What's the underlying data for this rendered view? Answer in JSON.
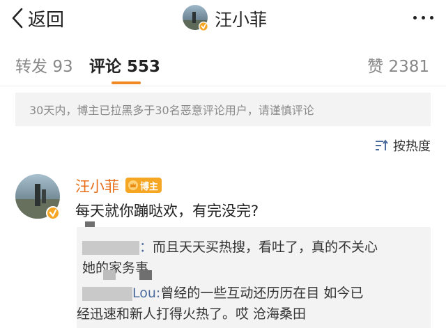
{
  "navbar": {
    "back_label": "返回",
    "title": "汪小菲"
  },
  "tabs": [
    {
      "label": "转发",
      "count": "93"
    },
    {
      "label": "评论",
      "count": "553"
    },
    {
      "label": "赞",
      "count": "2381"
    }
  ],
  "notice": "30天内，博主已拉黑多于30名恶意评论用户，请谨慎评论",
  "sort": {
    "label": "按热度"
  },
  "comment": {
    "author": "汪小菲",
    "tag": "博主",
    "text": "每天就你蹦哒欢，有完没完?"
  },
  "replies": [
    {
      "user_suffix": "：",
      "line1": "而且天天买热搜，看吐了，真的不关心",
      "line2": "她的家务事"
    },
    {
      "user_suffix": "Lou:",
      "line1": "曾经的一些互动还历历在目 如今已",
      "line2": "经迅速和新人打得火热了。哎 沧海桑田"
    }
  ],
  "colors": {
    "accent": "#f08a25",
    "name": "#e86f1b",
    "link": "#4a6a9c",
    "tag_bg": "#f5a623"
  }
}
